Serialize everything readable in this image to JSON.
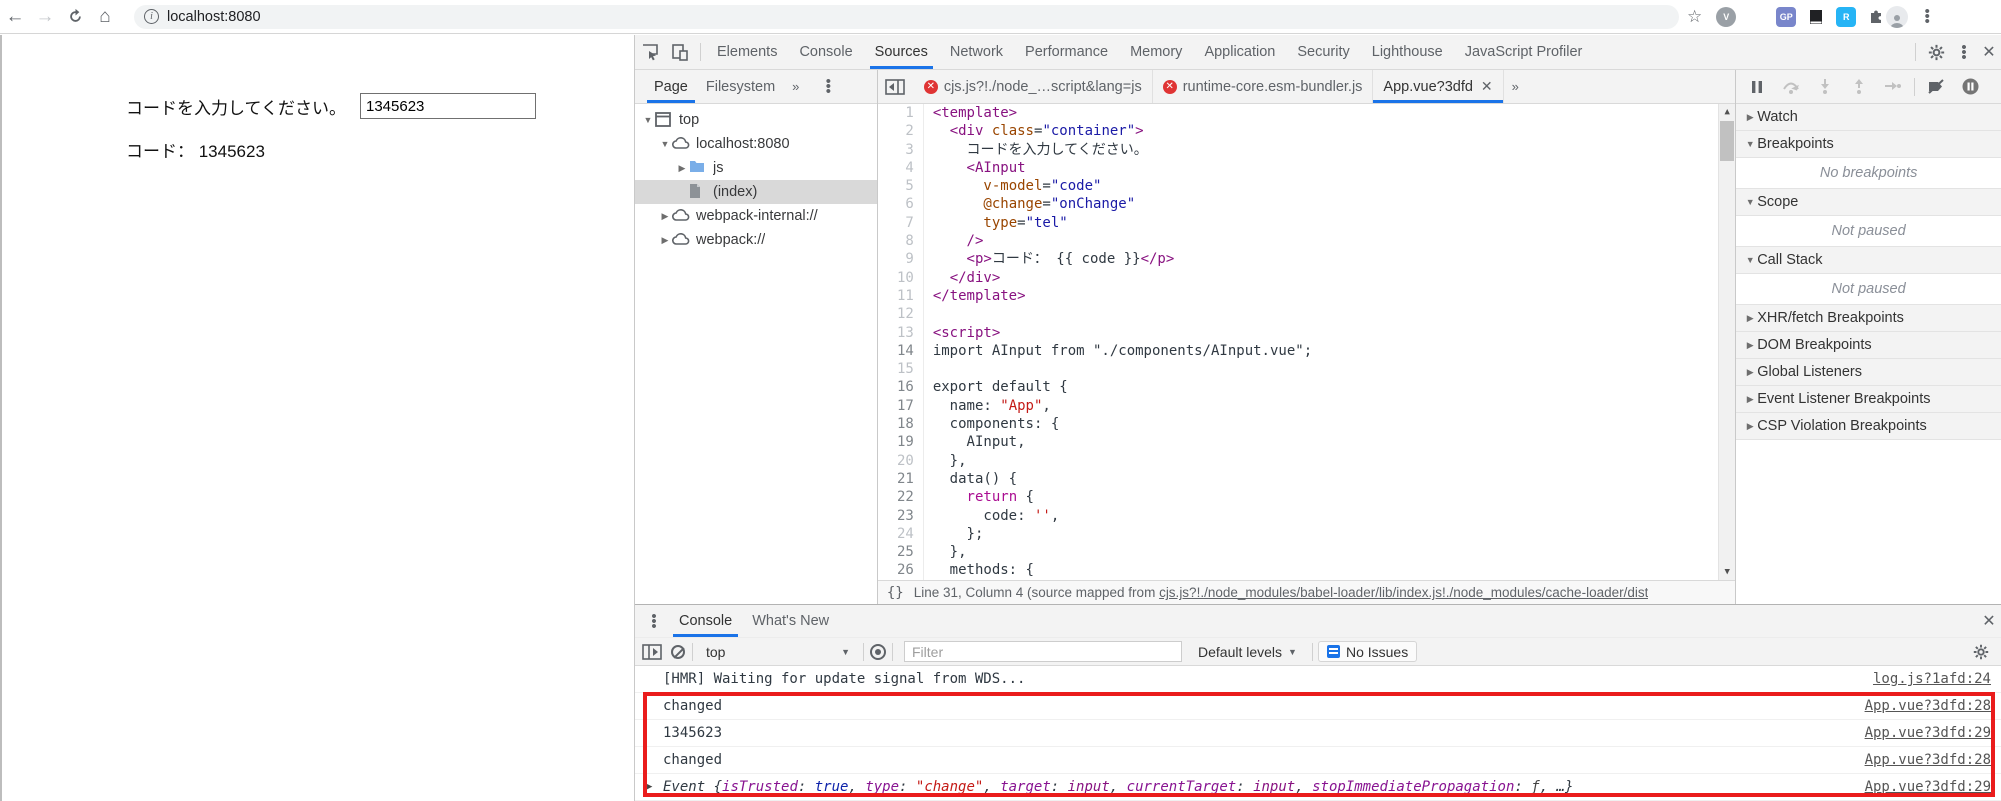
{
  "colors": {
    "accent": "#1a73e8",
    "error_badge": "#df3434",
    "annotation": "#ea1c1c",
    "selection": "#d9d9d9"
  },
  "browser_toolbar": {
    "url": "localhost:8080",
    "extensions": [
      {
        "label": "V",
        "bg": "#9aa0a6",
        "shape": "circle",
        "name": "vue-devtools-extension"
      },
      {
        "label": "",
        "bg": "#3c4043",
        "shape": "gear",
        "name": "gear-extension"
      },
      {
        "label": "GP",
        "bg": "#7986cb",
        "shape": "square",
        "name": "gp-extension"
      },
      {
        "label": "",
        "bg": "#202124",
        "shape": "book",
        "name": "notebook-extension"
      },
      {
        "label": "R",
        "bg": "#26b4f5",
        "shape": "square",
        "name": "r-extension"
      },
      {
        "label": "",
        "bg": "#5f6368",
        "shape": "puzzle",
        "name": "extensions-puzzle"
      }
    ]
  },
  "page": {
    "prompt": "コードを入力してください。",
    "input_value": "1345623",
    "result_label": "コード： 1345623"
  },
  "devtools": {
    "main_tabs": [
      "Elements",
      "Console",
      "Sources",
      "Network",
      "Performance",
      "Memory",
      "Application",
      "Security",
      "Lighthouse",
      "JavaScript Profiler"
    ],
    "active_main_tab": "Sources",
    "navigator": {
      "tabs": [
        "Page",
        "Filesystem"
      ],
      "active_tab": "Page",
      "tree": [
        {
          "label": "top",
          "icon": "frame",
          "depth": 0,
          "expander": "open",
          "selected": false
        },
        {
          "label": "localhost:8080",
          "icon": "cloud",
          "depth": 1,
          "expander": "open",
          "selected": false
        },
        {
          "label": "js",
          "icon": "folder",
          "depth": 2,
          "expander": "closed",
          "selected": false
        },
        {
          "label": "(index)",
          "icon": "document",
          "depth": 2,
          "expander": "none",
          "selected": true
        },
        {
          "label": "webpack-internal://",
          "icon": "cloud",
          "depth": 1,
          "expander": "closed",
          "selected": false
        },
        {
          "label": "webpack://",
          "icon": "cloud",
          "depth": 1,
          "expander": "closed",
          "selected": false
        }
      ]
    },
    "editor": {
      "tabs": [
        {
          "label": "cjs.js?!./node_…script&lang=js",
          "error": true,
          "active": false,
          "closable": false
        },
        {
          "label": "runtime-core.esm-bundler.js",
          "error": true,
          "active": false,
          "closable": false
        },
        {
          "label": "App.vue?3dfd",
          "error": false,
          "active": true,
          "closable": true
        }
      ],
      "lines": [
        {
          "n": 1,
          "g": "dim",
          "tokens": [
            [
              "tag",
              "<template>"
            ]
          ]
        },
        {
          "n": 2,
          "g": "dim",
          "tokens": [
            [
              "plain",
              "  "
            ],
            [
              "tag",
              "<div"
            ],
            [
              "plain",
              " "
            ],
            [
              "attr",
              "class"
            ],
            [
              "plain",
              "="
            ],
            [
              "str",
              "\"container\""
            ],
            [
              "tag",
              ">"
            ]
          ]
        },
        {
          "n": 3,
          "g": "dim",
          "tokens": [
            [
              "plain",
              "    コードを入力してください。"
            ]
          ]
        },
        {
          "n": 4,
          "g": "dim",
          "tokens": [
            [
              "plain",
              "    "
            ],
            [
              "tag",
              "<AInput"
            ]
          ]
        },
        {
          "n": 5,
          "g": "dim",
          "tokens": [
            [
              "plain",
              "      "
            ],
            [
              "attr",
              "v-model"
            ],
            [
              "plain",
              "="
            ],
            [
              "str",
              "\"code\""
            ]
          ]
        },
        {
          "n": 6,
          "g": "dim",
          "tokens": [
            [
              "plain",
              "      "
            ],
            [
              "attr",
              "@change"
            ],
            [
              "plain",
              "="
            ],
            [
              "str",
              "\"onChange\""
            ]
          ]
        },
        {
          "n": 7,
          "g": "dim",
          "tokens": [
            [
              "plain",
              "      "
            ],
            [
              "attr",
              "type"
            ],
            [
              "plain",
              "="
            ],
            [
              "str",
              "\"tel\""
            ]
          ]
        },
        {
          "n": 8,
          "g": "dim",
          "tokens": [
            [
              "plain",
              "    "
            ],
            [
              "tag",
              "/>"
            ]
          ]
        },
        {
          "n": 9,
          "g": "dim",
          "tokens": [
            [
              "plain",
              "    "
            ],
            [
              "tag",
              "<p>"
            ],
            [
              "plain",
              "コード： {{ code }}"
            ],
            [
              "tag",
              "</p>"
            ]
          ]
        },
        {
          "n": 10,
          "g": "dim",
          "tokens": [
            [
              "plain",
              "  "
            ],
            [
              "tag",
              "</div>"
            ]
          ]
        },
        {
          "n": 11,
          "g": "dim",
          "tokens": [
            [
              "tag",
              "</template>"
            ]
          ]
        },
        {
          "n": 12,
          "g": "dim",
          "tokens": []
        },
        {
          "n": 13,
          "g": "dim",
          "tokens": [
            [
              "tag",
              "<script>"
            ]
          ]
        },
        {
          "n": 14,
          "g": "strong",
          "tokens": [
            [
              "plain",
              "import AInput from \"./components/AInput.vue\";"
            ]
          ]
        },
        {
          "n": 15,
          "g": "dim",
          "tokens": []
        },
        {
          "n": 16,
          "g": "strong",
          "tokens": [
            [
              "plain",
              "export default {"
            ]
          ]
        },
        {
          "n": 17,
          "g": "strong",
          "tokens": [
            [
              "plain",
              "  name: "
            ],
            [
              "jsstr",
              "\"App\""
            ],
            [
              "plain",
              ","
            ]
          ]
        },
        {
          "n": 18,
          "g": "strong",
          "tokens": [
            [
              "plain",
              "  components: {"
            ]
          ]
        },
        {
          "n": 19,
          "g": "strong",
          "tokens": [
            [
              "plain",
              "    AInput,"
            ]
          ]
        },
        {
          "n": 20,
          "g": "dim",
          "tokens": [
            [
              "plain",
              "  },"
            ]
          ]
        },
        {
          "n": 21,
          "g": "strong",
          "tokens": [
            [
              "plain",
              "  data() {"
            ]
          ]
        },
        {
          "n": 22,
          "g": "strong",
          "tokens": [
            [
              "plain",
              "    "
            ],
            [
              "kw",
              "return"
            ],
            [
              "plain",
              " {"
            ]
          ]
        },
        {
          "n": 23,
          "g": "strong",
          "tokens": [
            [
              "plain",
              "      code: "
            ],
            [
              "jsstr",
              "''"
            ],
            [
              "plain",
              ","
            ]
          ]
        },
        {
          "n": 24,
          "g": "dim",
          "tokens": [
            [
              "plain",
              "    };"
            ]
          ]
        },
        {
          "n": 25,
          "g": "strong",
          "tokens": [
            [
              "plain",
              "  },"
            ]
          ]
        },
        {
          "n": 26,
          "g": "strong",
          "tokens": [
            [
              "plain",
              "  methods: {"
            ]
          ]
        }
      ],
      "status": {
        "braces": "{}",
        "prefix": "Line 31, Column 4 (source mapped from ",
        "link": "cjs.js?!./node_modules/babel-loader/lib/index.js!./node_modules/cache-loader/dist"
      }
    },
    "debugger": {
      "sections": [
        {
          "label": "Watch",
          "state": "collapsed",
          "body": ""
        },
        {
          "label": "Breakpoints",
          "state": "expanded",
          "body": "No breakpoints"
        },
        {
          "label": "Scope",
          "state": "expanded",
          "body": "Not paused"
        },
        {
          "label": "Call Stack",
          "state": "expanded",
          "body": "Not paused"
        },
        {
          "label": "XHR/fetch Breakpoints",
          "state": "collapsed",
          "body": ""
        },
        {
          "label": "DOM Breakpoints",
          "state": "collapsed",
          "body": ""
        },
        {
          "label": "Global Listeners",
          "state": "collapsed",
          "body": ""
        },
        {
          "label": "Event Listener Breakpoints",
          "state": "collapsed",
          "body": ""
        },
        {
          "label": "CSP Violation Breakpoints",
          "state": "collapsed",
          "body": ""
        }
      ]
    },
    "console": {
      "tabs": [
        "Console",
        "What's New"
      ],
      "active_tab": "Console",
      "context": "top",
      "filter_placeholder": "Filter",
      "levels_label": "Default levels",
      "issues_label": "No Issues",
      "messages": [
        {
          "expand": false,
          "italic": false,
          "link": "log.js?1afd:24",
          "tokens": [
            [
              "plain",
              "[HMR] Waiting for update signal from WDS..."
            ]
          ]
        },
        {
          "expand": false,
          "italic": false,
          "link": "App.vue?3dfd:28",
          "tokens": [
            [
              "plain",
              "changed"
            ]
          ]
        },
        {
          "expand": false,
          "italic": false,
          "link": "App.vue?3dfd:29",
          "tokens": [
            [
              "plain",
              "1345623"
            ]
          ]
        },
        {
          "expand": false,
          "italic": false,
          "link": "App.vue?3dfd:28",
          "tokens": [
            [
              "plain",
              "changed"
            ]
          ]
        },
        {
          "expand": true,
          "italic": true,
          "link": "App.vue?3dfd:29",
          "tokens": [
            [
              "obj",
              "Event "
            ],
            [
              "plain",
              "{"
            ],
            [
              "prop",
              "isTrusted"
            ],
            [
              "plain",
              ": "
            ],
            [
              "bool",
              "true"
            ],
            [
              "plain",
              ", "
            ],
            [
              "prop",
              "type"
            ],
            [
              "plain",
              ": "
            ],
            [
              "str",
              "\"change\""
            ],
            [
              "plain",
              ", "
            ],
            [
              "prop",
              "target"
            ],
            [
              "plain",
              ": "
            ],
            [
              "node",
              "input"
            ],
            [
              "plain",
              ", "
            ],
            [
              "prop",
              "currentTarget"
            ],
            [
              "plain",
              ": "
            ],
            [
              "node",
              "input"
            ],
            [
              "plain",
              ", "
            ],
            [
              "prop",
              "stopImmediatePropagation"
            ],
            [
              "plain",
              ": "
            ],
            [
              "func",
              "ƒ"
            ],
            [
              "plain",
              ", …}"
            ]
          ]
        }
      ]
    }
  }
}
